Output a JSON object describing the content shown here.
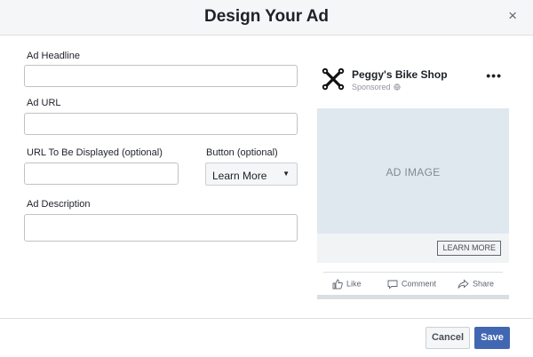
{
  "dialog": {
    "title": "Design Your Ad",
    "close_glyph": "×"
  },
  "form": {
    "headline_label": "Ad Headline",
    "headline_value": "",
    "url_label": "Ad URL",
    "url_value": "",
    "display_url_label": "URL To Be Displayed (optional)",
    "display_url_value": "",
    "button_label": "Button (optional)",
    "button_value": "Learn More",
    "description_label": "Ad Description",
    "description_value": ""
  },
  "preview": {
    "page_name": "Peggy's Bike Shop",
    "sponsored": "Sponsored",
    "globe_icon": "globe-icon",
    "more_glyph": "•••",
    "image_placeholder": "AD IMAGE",
    "cta": "LEARN MORE",
    "actions": {
      "like": "Like",
      "comment": "Comment",
      "share": "Share"
    }
  },
  "footer": {
    "cancel": "Cancel",
    "save": "Save"
  },
  "colors": {
    "header_bg": "#f5f6f7",
    "save_bg": "#4267b2",
    "image_bg": "#dfe8ef"
  }
}
